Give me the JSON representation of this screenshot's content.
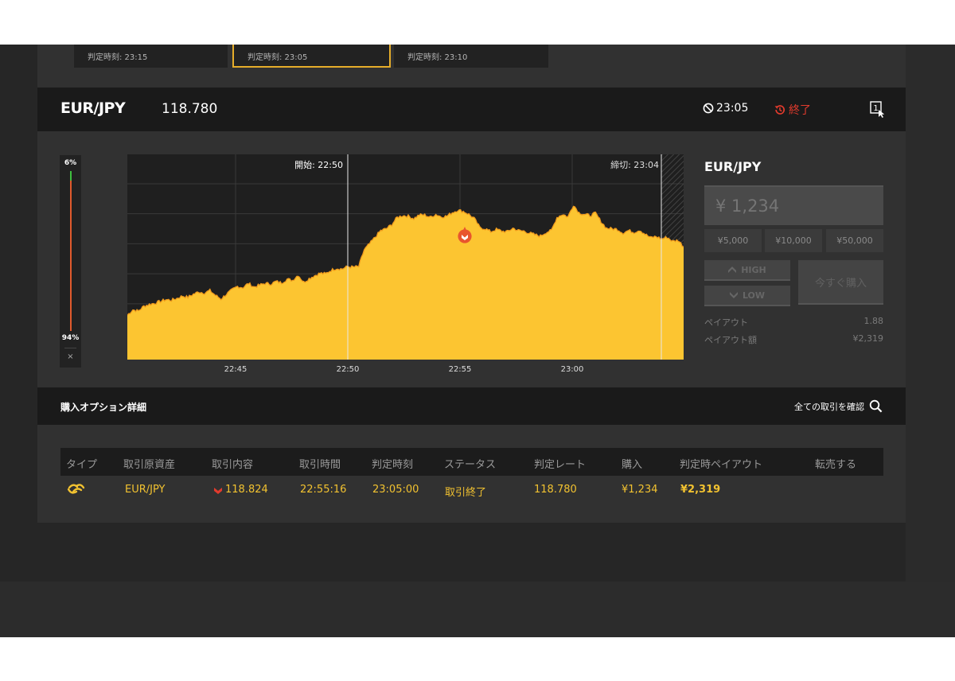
{
  "expiry_tabs": [
    {
      "label": "判定時刻: 23:15",
      "selected": false
    },
    {
      "label": "判定時刻: 23:05",
      "selected": true
    },
    {
      "label": "判定時刻: 23:10",
      "selected": false
    }
  ],
  "header": {
    "pair": "EUR/JPY",
    "rate": "118.780",
    "expiry_time": "23:05",
    "status": "終了",
    "window_number": "1"
  },
  "sentiment": {
    "high_pct": "6%",
    "low_pct": "94%",
    "high_fraction": 0.06,
    "close": "×"
  },
  "chart_data": {
    "type": "area",
    "y_ticks": [
      "118.90",
      "118.85",
      "118.80",
      "118.75",
      "118.70",
      "118.65"
    ],
    "x_ticks": [
      "22:45",
      "22:50",
      "22:55",
      "23:00"
    ],
    "ylim": [
      118.607,
      118.949
    ],
    "start_label": "開始: 22:50",
    "close_label": "締切: 23:04",
    "series_color": "#fcc531",
    "outline_color": "#ef9a1c",
    "entry_marker": {
      "direction": "low",
      "rate": 118.824,
      "time": "22:55:16"
    },
    "samples": [
      118.681,
      118.69,
      118.688,
      118.696,
      118.699,
      118.701,
      118.704,
      118.707,
      118.706,
      118.709,
      118.713,
      118.711,
      118.716,
      118.72,
      118.718,
      118.722,
      118.714,
      118.708,
      118.716,
      118.723,
      118.729,
      118.727,
      118.734,
      118.728,
      118.731,
      118.734,
      118.733,
      118.737,
      118.735,
      118.741,
      118.739,
      118.748,
      118.736,
      118.742,
      118.747,
      118.751,
      118.75,
      118.756,
      118.759,
      118.758,
      118.762,
      118.761,
      118.762,
      118.79,
      118.8,
      118.811,
      118.822,
      118.825,
      118.832,
      118.844,
      118.847,
      118.846,
      118.842,
      118.848,
      118.848,
      118.844,
      118.849,
      118.845,
      118.846,
      118.852,
      118.856,
      118.854,
      118.849,
      118.842,
      118.827,
      118.825,
      118.82,
      118.824,
      118.821,
      118.82,
      118.826,
      118.822,
      118.821,
      118.818,
      118.815,
      118.813,
      118.819,
      118.822,
      118.844,
      118.849,
      118.845,
      118.865,
      118.852,
      118.849,
      118.847,
      118.851,
      118.837,
      118.826,
      118.825,
      118.824,
      118.818,
      118.822,
      118.819,
      118.823,
      118.816,
      118.81,
      118.812,
      118.808,
      118.811,
      118.804,
      118.806,
      118.795
    ]
  },
  "trade_panel": {
    "pair": "EUR/JPY",
    "amount_placeholder": "¥ 1,234",
    "amount_buttons": [
      "¥5,000",
      "¥10,000",
      "¥50,000"
    ],
    "high_label": "HIGH",
    "low_label": "LOW",
    "buy_now_label": "今すぐ購入",
    "payout_label": "ペイアウト",
    "payout_value": "1.88",
    "payout_amount_label": "ペイアウト額",
    "payout_amount_value": "¥2,319"
  },
  "details": {
    "title": "購入オプション詳細",
    "all_trades_label": "全ての取引を確認",
    "columns": [
      "タイプ",
      "取引原資産",
      "取引内容",
      "取引時間",
      "判定時刻",
      "ステータス",
      "判定レート",
      "購入",
      "判定時ペイアウト",
      "転売する"
    ],
    "row": {
      "type_icon": "trade-type-icon",
      "asset": "EUR/JPY",
      "direction_icon": "low-arrow-icon",
      "content": "118.824",
      "trade_time": "22:55:16",
      "expiry": "23:05:00",
      "status": "取引終了",
      "expiry_rate": "118.780",
      "purchase": "¥1,234",
      "payout": "¥2,319"
    }
  }
}
